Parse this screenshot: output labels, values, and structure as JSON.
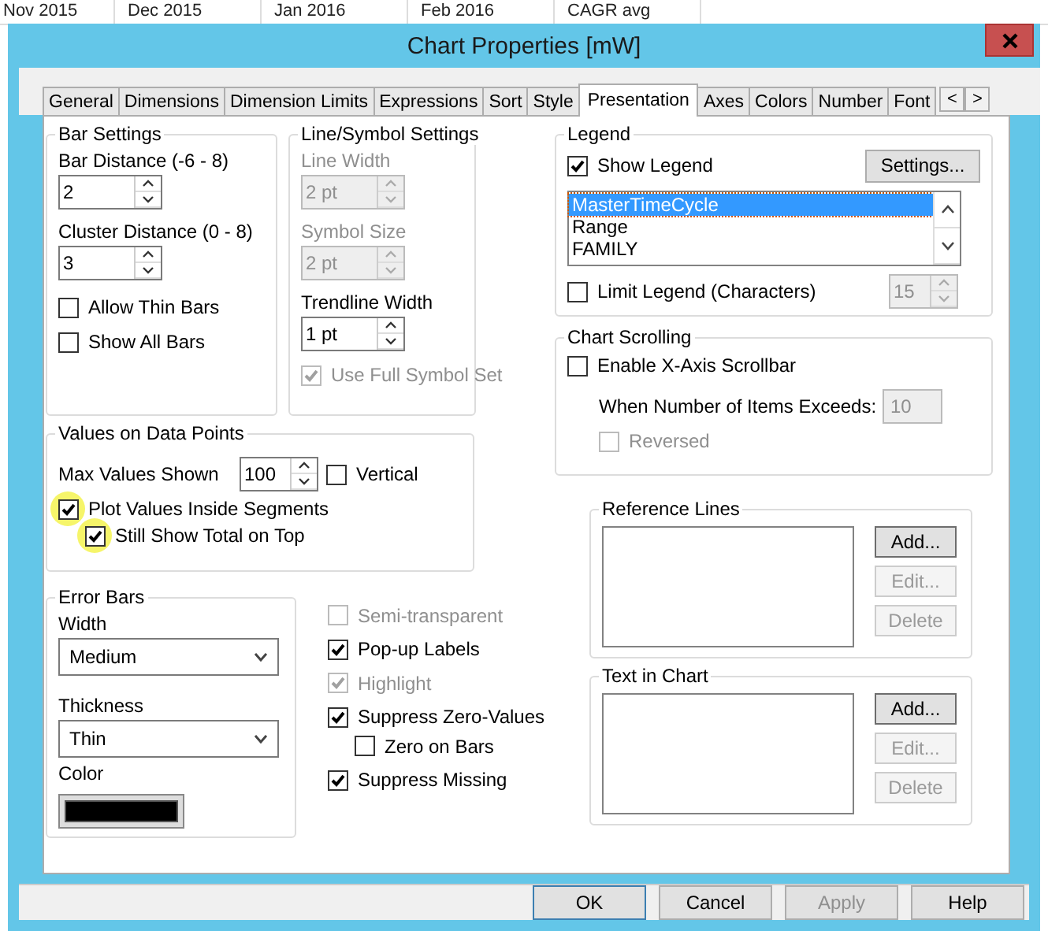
{
  "background_headers": [
    "Nov 2015",
    "Dec 2015",
    "Jan 2016",
    "Feb 2016",
    "CAGR avg"
  ],
  "window": {
    "title": "Chart Properties [mW]"
  },
  "tabs": [
    {
      "label": "General",
      "selected": false
    },
    {
      "label": "Dimensions",
      "selected": false
    },
    {
      "label": "Dimension Limits",
      "selected": false
    },
    {
      "label": "Expressions",
      "selected": false
    },
    {
      "label": "Sort",
      "selected": false
    },
    {
      "label": "Style",
      "selected": false
    },
    {
      "label": "Presentation",
      "selected": true
    },
    {
      "label": "Axes",
      "selected": false
    },
    {
      "label": "Colors",
      "selected": false
    },
    {
      "label": "Number",
      "selected": false
    },
    {
      "label": "Font",
      "selected": false
    }
  ],
  "tab_scroll_buttons": [
    "<",
    ">"
  ],
  "bar_settings": {
    "title": "Bar Settings",
    "fields": [
      {
        "label": "Bar Distance (-6 - 8)",
        "value": "2",
        "disabled": false
      },
      {
        "label": "Cluster Distance (0 - 8)",
        "value": "3",
        "disabled": false
      }
    ],
    "checkboxes": [
      {
        "label": "Allow Thin Bars",
        "checked": false,
        "disabled": false
      },
      {
        "label": "Show All Bars",
        "checked": false,
        "disabled": false
      }
    ]
  },
  "line_symbol_settings": {
    "title": "Line/Symbol Settings",
    "fields": [
      {
        "label": "Line Width",
        "value": "2 pt",
        "disabled": true
      },
      {
        "label": "Symbol Size",
        "value": "2 pt",
        "disabled": true
      },
      {
        "label": "Trendline Width",
        "value": "1 pt",
        "disabled": false
      }
    ],
    "checkboxes": [
      {
        "label": "Use Full Symbol Set",
        "checked": true,
        "disabled": true
      }
    ]
  },
  "values_on_data_points": {
    "title": "Values on Data Points",
    "max_values": {
      "label": "Max Values Shown",
      "value": "100"
    },
    "vertical": {
      "label": "Vertical",
      "checked": false
    },
    "checkboxes": [
      {
        "label": "Plot Values Inside Segments",
        "checked": true,
        "highlighted": true,
        "children": [
          {
            "label": "Still Show Total on Top",
            "checked": true,
            "highlighted": true
          }
        ]
      }
    ]
  },
  "error_bars": {
    "title": "Error Bars",
    "width": {
      "label": "Width",
      "value": "Medium"
    },
    "thickness": {
      "label": "Thickness",
      "value": "Thin"
    },
    "color": {
      "label": "Color",
      "color": "#000000"
    }
  },
  "options": [
    {
      "label": "Semi-transparent",
      "checked": false,
      "disabled": true
    },
    {
      "label": "Pop-up Labels",
      "checked": true,
      "disabled": false
    },
    {
      "label": "Highlight",
      "checked": true,
      "disabled": true
    },
    {
      "label": "Suppress Zero-Values",
      "checked": true,
      "disabled": false,
      "children": [
        {
          "label": "Zero on Bars",
          "checked": false,
          "disabled": false
        }
      ]
    },
    {
      "label": "Suppress Missing",
      "checked": true,
      "disabled": false
    }
  ],
  "legend": {
    "title": "Legend",
    "show_legend": {
      "label": "Show Legend",
      "checked": true
    },
    "settings_button": "Settings...",
    "items": [
      {
        "label": "MasterTimeCycle",
        "selected": true
      },
      {
        "label": "Range",
        "selected": false
      },
      {
        "label": "FAMILY",
        "selected": false
      }
    ],
    "limit_legend": {
      "label": "Limit Legend (Characters)",
      "checked": false,
      "value": "15",
      "value_disabled": true
    }
  },
  "chart_scrolling": {
    "title": "Chart Scrolling",
    "enable": {
      "label": "Enable X-Axis Scrollbar",
      "checked": false
    },
    "items_label": "When Number of Items Exceeds:",
    "items_value": "10",
    "items_disabled": true,
    "reversed": {
      "label": "Reversed",
      "checked": false,
      "disabled": true
    }
  },
  "reference_lines": {
    "title": "Reference Lines",
    "buttons": [
      {
        "label": "Add...",
        "disabled": false
      },
      {
        "label": "Edit...",
        "disabled": true
      },
      {
        "label": "Delete",
        "disabled": true
      }
    ]
  },
  "text_in_chart": {
    "title": "Text in Chart",
    "buttons": [
      {
        "label": "Add...",
        "disabled": false
      },
      {
        "label": "Edit...",
        "disabled": true
      },
      {
        "label": "Delete",
        "disabled": true
      }
    ]
  },
  "footer_buttons": [
    {
      "label": "OK",
      "disabled": false,
      "default": true
    },
    {
      "label": "Cancel",
      "disabled": false,
      "default": false
    },
    {
      "label": "Apply",
      "disabled": true,
      "default": false
    },
    {
      "label": "Help",
      "disabled": false,
      "default": false
    }
  ]
}
